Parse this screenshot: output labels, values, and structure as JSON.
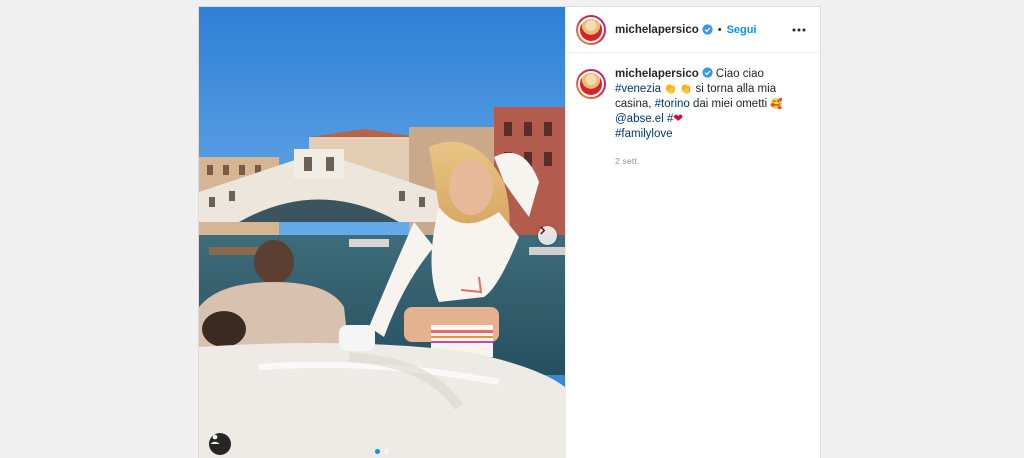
{
  "post": {
    "username": "michelapersico",
    "follow_label": "Segui",
    "separator": "•",
    "caption": {
      "username": "michelapersico",
      "t1": " Ciao ciao ",
      "h1": "#venezia",
      "e1": "👏",
      "e2": "👏",
      "t2": " si torna alla mia casina, ",
      "h2": "#torino",
      "t3": " dai miei ometti ",
      "e3": "🥰",
      "mention": "@abse.el",
      "h3": "#",
      "heart": "❤",
      "h4": "#familylove"
    },
    "time_ago": "2 sett.",
    "carousel": {
      "slide_count": 2,
      "active_index": 0
    }
  },
  "colors": {
    "accent": "#0095f6",
    "hashtag": "#00376b",
    "verified": "#3897f0",
    "timestamp": "#8e8e8e"
  },
  "icons": {
    "verified": "verified-badge-icon",
    "more": "more-options-icon",
    "next": "chevron-right-icon",
    "tags": "user-tag-icon"
  }
}
